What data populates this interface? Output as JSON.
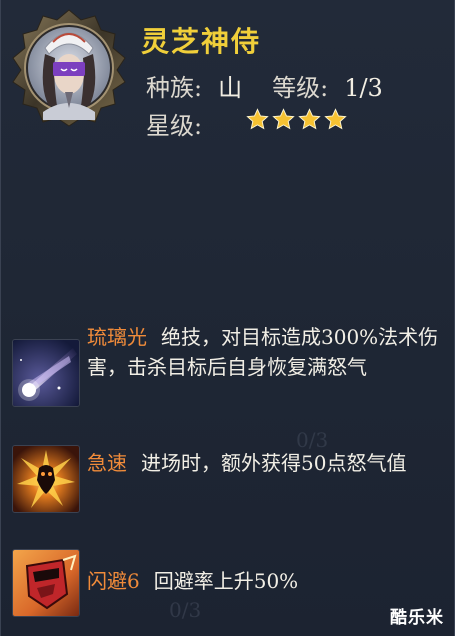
{
  "character": {
    "name": "灵芝神侍",
    "race_label": "种族:",
    "race_value": "山",
    "level_label": "等级:",
    "level_value": "1/3",
    "star_label": "星级:",
    "stars": 4
  },
  "skills": [
    {
      "name": "琉璃光",
      "description": "绝技，对目标造成300%法术伤害，击杀目标后自身恢复满怒气",
      "icon": "crystal-light-comet-icon"
    },
    {
      "name": "急速",
      "description": "进场时，额外获得50点怒气值",
      "icon": "haste-burst-icon"
    },
    {
      "name": "闪避6",
      "description": "回避率上升50%",
      "icon": "dodge-mask-icon"
    }
  ],
  "ghost_text": {
    "a": "0/3",
    "b": "0/3"
  },
  "watermark": "酷乐米",
  "colors": {
    "name_gold": "#f0cf3a",
    "skill_orange": "#f08b3a",
    "background": "#1f2735",
    "star_gold": "#f6c232"
  }
}
